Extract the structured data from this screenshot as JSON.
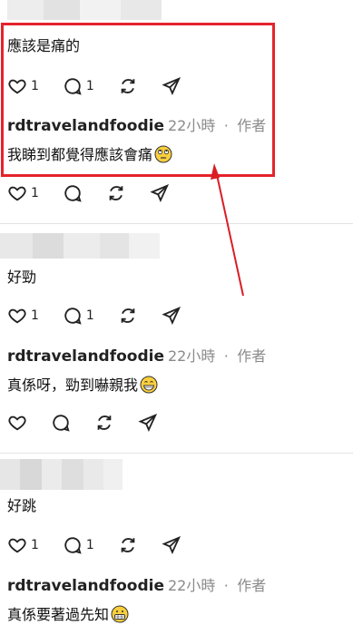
{
  "colors": {
    "highlight": "#e5232b",
    "arrow": "#d91e26",
    "muted": "#8a8a8a"
  },
  "comments": [
    {
      "text": "應該是痛的",
      "likes": "1",
      "replies": "1",
      "reply": {
        "author": "rdtravelandfoodie",
        "time": "22小時",
        "role": "作者",
        "text": "我睇到都覺得應該會痛",
        "emoji": "face-with-rolling-eyes"
      },
      "reply_likes": "1"
    },
    {
      "text": "好勁",
      "likes": "1",
      "replies": "1",
      "reply": {
        "author": "rdtravelandfoodie",
        "time": "22小時",
        "role": "作者",
        "text": "真係呀，勁到嚇親我",
        "emoji": "grinning-face"
      }
    },
    {
      "text": "好跳",
      "likes": "1",
      "replies": "1",
      "reply": {
        "author": "rdtravelandfoodie",
        "time": "22小時",
        "role": "作者",
        "text": "真係要著過先知",
        "emoji": "grimacing-face"
      }
    }
  ],
  "separator": "·",
  "icons": [
    "heart-icon",
    "comment-icon",
    "repost-icon",
    "share-icon"
  ]
}
